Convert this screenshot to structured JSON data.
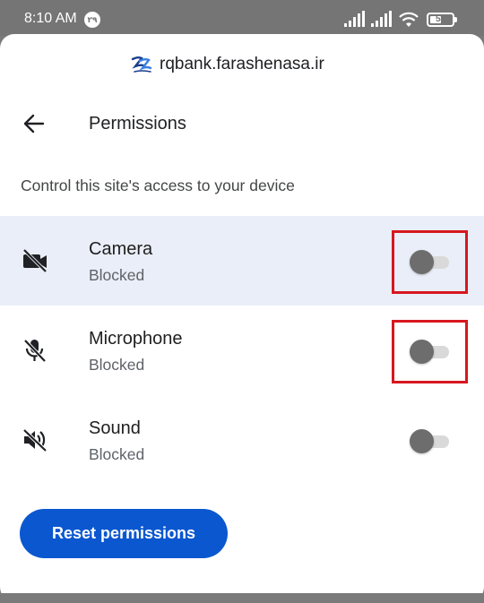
{
  "status_bar": {
    "time": "8:10 AM",
    "badge": "۲۹",
    "battery": "54",
    "battery_level_percent": 54
  },
  "site": {
    "url": "rqbank.farashenasa.ir",
    "logo_icon": "site-logo-icon"
  },
  "header": {
    "back_icon": "arrow-back-icon",
    "title": "Permissions"
  },
  "description": "Control this site's access to your device",
  "permissions": [
    {
      "name": "Camera",
      "status": "Blocked",
      "icon": "camera-off-icon",
      "enabled": false
    },
    {
      "name": "Microphone",
      "status": "Blocked",
      "icon": "mic-off-icon",
      "enabled": false
    },
    {
      "name": "Sound",
      "status": "Blocked",
      "icon": "volume-off-icon",
      "enabled": false
    }
  ],
  "reset_button_label": "Reset permissions",
  "colors": {
    "accent": "#0b57d0",
    "highlight_row": "#e9eef8",
    "annotation_box": "#d7171f"
  }
}
